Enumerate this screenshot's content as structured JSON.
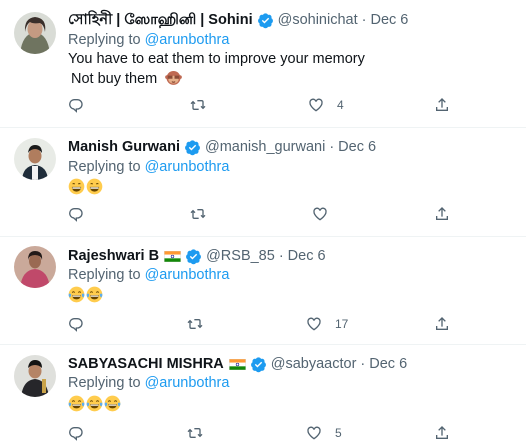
{
  "tweets": [
    {
      "name": "সোহিনী | ஸோஹினி | Sohini",
      "handle": "@sohinichat",
      "date": "Dec 6",
      "replying_prefix": "Replying to",
      "replying_to": "@arunbothra",
      "lines": [
        "You have to eat them to improve your memory",
        "Not buy them"
      ],
      "line2_emoji": "see-no-evil-monkey-icon",
      "likes": "4"
    },
    {
      "name": "Manish Gurwani",
      "handle": "@manish_gurwani",
      "date": "Dec 6",
      "replying_prefix": "Replying to",
      "replying_to": "@arunbothra",
      "emojis": [
        "grinning-face-icon",
        "grinning-face-icon"
      ],
      "likes": ""
    },
    {
      "name": "Rajeshwari B",
      "handle": "@RSB_85",
      "date": "Dec 6",
      "replying_prefix": "Replying to",
      "replying_to": "@arunbothra",
      "emojis": [
        "tears-of-joy-icon",
        "tears-of-joy-icon"
      ],
      "likes": "17"
    },
    {
      "name": "SABYASACHI MISHRA",
      "handle": "@sabyaactor",
      "date": "Dec 6",
      "replying_prefix": "Replying to",
      "replying_to": "@arunbothra",
      "emojis": [
        "tears-of-joy-icon",
        "tears-of-joy-icon",
        "tears-of-joy-icon"
      ],
      "likes": "5"
    }
  ],
  "colors": {
    "link": "#1d9bf0",
    "secondary": "#536471",
    "verified": "#1d9bf0"
  }
}
